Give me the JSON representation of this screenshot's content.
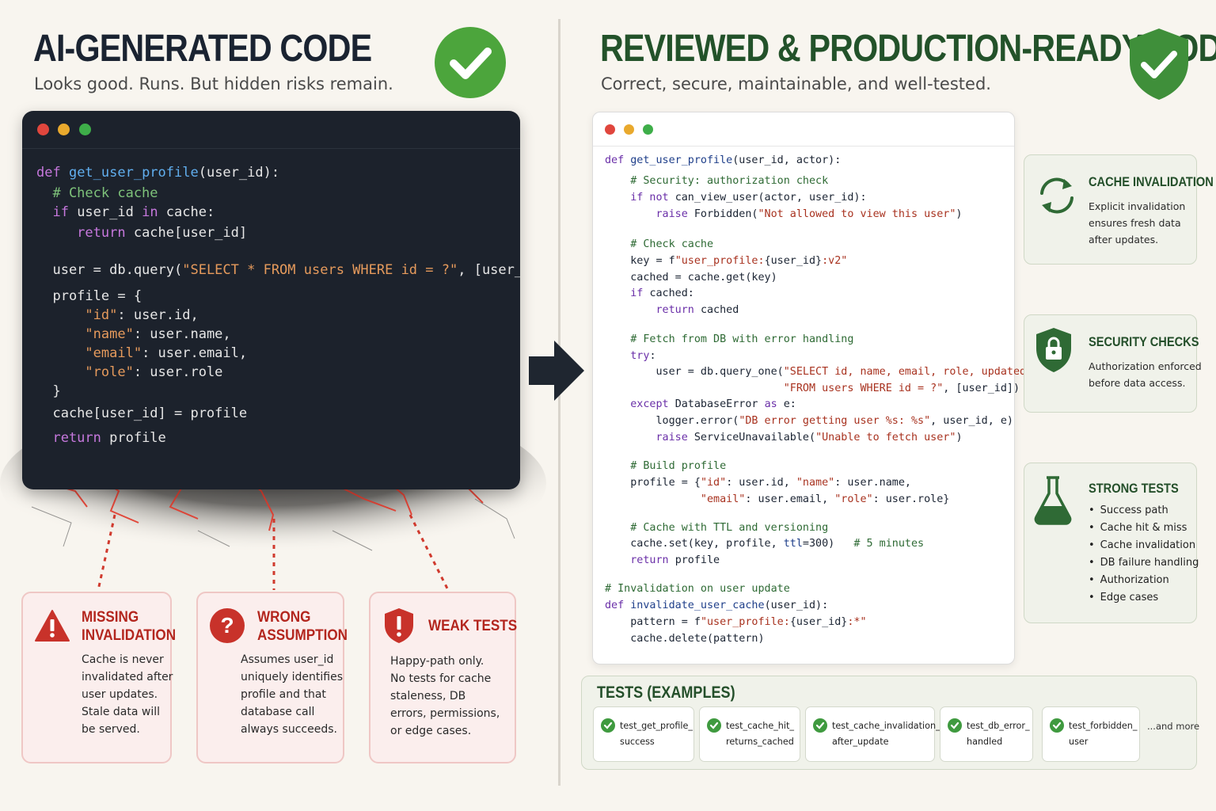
{
  "left": {
    "title": "AI-GENERATED CODE",
    "subtitle": "Looks good. Runs. But hidden risks remain.",
    "code_lines": [
      [
        [
          "kw",
          "def "
        ],
        [
          "fn",
          "get_user_profile"
        ],
        [
          "",
          "(user_id):"
        ]
      ],
      [
        [
          "cm",
          "  # Check cache"
        ]
      ],
      [
        [
          "kw",
          "  if "
        ],
        [
          "",
          "user_id "
        ],
        [
          "kw",
          "in "
        ],
        [
          "",
          "cache:"
        ]
      ],
      [
        [
          "kw",
          "     return "
        ],
        [
          "",
          "cache[user_id]"
        ]
      ],
      [
        [
          "",
          "  user = db.query("
        ],
        [
          "st",
          "\"SELECT * FROM users WHERE id = ?\""
        ],
        [
          "",
          ", [user_id])"
        ]
      ],
      [
        [
          "",
          "  profile = {"
        ]
      ],
      [
        [
          "st",
          "      \"id\""
        ],
        [
          "",
          ": user.id,"
        ]
      ],
      [
        [
          "st",
          "      \"name\""
        ],
        [
          "",
          ": user.name,"
        ]
      ],
      [
        [
          "st",
          "      \"email\""
        ],
        [
          "",
          ": user.email,"
        ]
      ],
      [
        [
          "st",
          "      \"role\""
        ],
        [
          "",
          ": user.role"
        ]
      ],
      [
        [
          "",
          "  }"
        ]
      ],
      [
        [
          "",
          "  cache[user_id] = profile"
        ]
      ],
      [
        [
          "kw",
          "  return "
        ],
        [
          "",
          "profile"
        ]
      ]
    ],
    "problems": [
      {
        "title1": "MISSING",
        "title2": "INVALIDATION",
        "body": [
          "Cache is never",
          "invalidated after",
          "user updates.",
          "Stale data will",
          "be served."
        ],
        "icon": "warning-triangle-icon"
      },
      {
        "title1": "WRONG",
        "title2": "ASSUMPTION",
        "body": [
          "Assumes user_id",
          "uniquely identifies",
          "profile and that",
          "database call",
          "always succeeds."
        ],
        "icon": "question-circle-icon"
      },
      {
        "title1": "WEAK TESTS",
        "title2": "",
        "body": [
          "Happy-path only.",
          "No tests for cache",
          "staleness, DB",
          "errors, permissions,",
          "or edge cases."
        ],
        "icon": "alert-shield-icon"
      }
    ]
  },
  "right": {
    "title": "REVIEWED & PRODUCTION-READY CODE",
    "subtitle": "Correct, secure, maintainable, and well-tested.",
    "code_lines": [
      [
        [
          "lk",
          "def "
        ],
        [
          "lf",
          "get_user_profile"
        ],
        [
          "",
          "(user_id, actor):"
        ]
      ],
      [
        [
          "lc",
          "    # Security: authorization check"
        ]
      ],
      [
        [
          "lk",
          "    if not "
        ],
        [
          "",
          "can_view_user(actor, user_id):"
        ]
      ],
      [
        [
          "lk",
          "        raise "
        ],
        [
          "",
          "Forbidden("
        ],
        [
          "ls",
          "\"Not allowed to view this user\""
        ],
        [
          "",
          ")"
        ]
      ],
      [
        [
          "lc",
          "    # Check cache"
        ]
      ],
      [
        [
          "",
          "    key = f"
        ],
        [
          "ls",
          "\"user_profile:"
        ],
        [
          "",
          "{user_id}"
        ],
        [
          "ls",
          ":v2\""
        ]
      ],
      [
        [
          "",
          "    cached = cache.get(key)"
        ]
      ],
      [
        [
          "lk",
          "    if "
        ],
        [
          "",
          "cached:"
        ]
      ],
      [
        [
          "lk",
          "        return "
        ],
        [
          "",
          "cached"
        ]
      ],
      [
        [
          "lc",
          "    # Fetch from DB with error handling"
        ]
      ],
      [
        [
          "lk",
          "    try"
        ],
        [
          "",
          ":"
        ]
      ],
      [
        [
          "",
          "        user = db.query_one("
        ],
        [
          "ls",
          "\"SELECT id, name, email, role, updated_at \""
        ]
      ],
      [
        [
          "ls",
          "                            \"FROM users WHERE id = ?\""
        ],
        [
          "",
          ", [user_id])"
        ]
      ],
      [
        [
          "lk",
          "    except "
        ],
        [
          "",
          "DatabaseError "
        ],
        [
          "lk",
          "as "
        ],
        [
          "",
          "e:"
        ]
      ],
      [
        [
          "",
          "        logger.error("
        ],
        [
          "ls",
          "\"DB error getting user %s: %s\""
        ],
        [
          "",
          ", user_id, e)"
        ]
      ],
      [
        [
          "lk",
          "        raise "
        ],
        [
          "",
          "ServiceUnavailable("
        ],
        [
          "ls",
          "\"Unable to fetch user\""
        ],
        [
          "",
          ")"
        ]
      ],
      [
        [
          "lc",
          "    # Build profile"
        ]
      ],
      [
        [
          "",
          "    profile = {"
        ],
        [
          "ls",
          "\"id\""
        ],
        [
          "",
          ": user.id, "
        ],
        [
          "ls",
          "\"name\""
        ],
        [
          "",
          ": user.name,"
        ]
      ],
      [
        [
          "ls",
          "               \"email\""
        ],
        [
          "",
          ": user.email, "
        ],
        [
          "ls",
          "\"role\""
        ],
        [
          "",
          ": user.role}"
        ]
      ],
      [
        [
          "lc",
          "    # Cache with TTL and versioning"
        ]
      ],
      [
        [
          "",
          "    cache.set(key, profile, "
        ],
        [
          "lf",
          "ttl"
        ],
        [
          "",
          "=300)   "
        ],
        [
          "lc",
          "# 5 minutes"
        ]
      ],
      [
        [
          "lk",
          "    return "
        ],
        [
          "",
          "profile"
        ]
      ],
      [
        [
          "lc",
          "# Invalidation on user update"
        ]
      ],
      [
        [
          "lk",
          "def "
        ],
        [
          "lf",
          "invalidate_user_cache"
        ],
        [
          "",
          "(user_id):"
        ]
      ],
      [
        [
          "",
          "    pattern = f"
        ],
        [
          "ls",
          "\"user_profile:"
        ],
        [
          "",
          "{user_id}"
        ],
        [
          "ls",
          ":*\""
        ]
      ],
      [
        [
          "",
          "    cache.delete(pattern)"
        ]
      ]
    ],
    "features": [
      {
        "title": "CACHE INVALIDATION",
        "body": [
          "Explicit invalidation",
          "ensures fresh data",
          "after updates."
        ],
        "icon": "refresh-cycle-icon"
      },
      {
        "title": "SECURITY CHECKS",
        "body": [
          "Authorization enforced",
          "before data access."
        ],
        "icon": "lock-shield-icon"
      },
      {
        "title": "STRONG TESTS",
        "items": [
          "Success path",
          "Cache hit & miss",
          "Cache invalidation",
          "DB failure handling",
          "Authorization",
          "Edge cases"
        ],
        "icon": "flask-icon"
      }
    ],
    "tests": {
      "title": "TESTS (EXAMPLES)",
      "items": [
        "test_get_profile_\nsuccess",
        "test_cache_hit_\nreturns_cached",
        "test_cache_invalidation_\nafter_update",
        "test_db_error_\nhandled",
        "test_forbidden_\nuser"
      ],
      "more": "...and more"
    }
  },
  "colors": {
    "success_green": "#4ca53c",
    "danger_red": "#c8322a",
    "dark_editor": "#1c222c"
  }
}
